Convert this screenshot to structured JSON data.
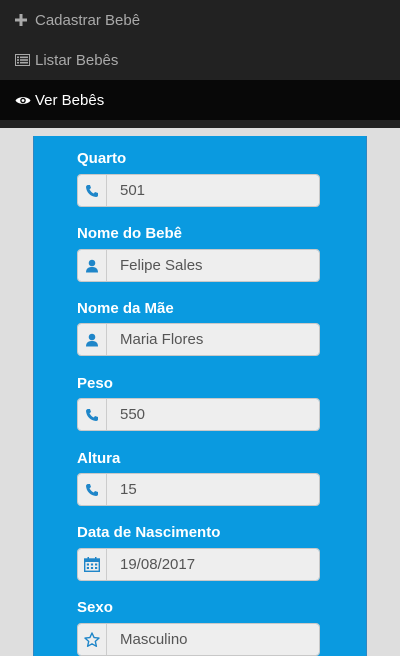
{
  "nav": {
    "items": [
      {
        "label": "Cadastrar Bebê",
        "icon": "plus-icon"
      },
      {
        "label": "Listar Bebês",
        "icon": "list-icon"
      },
      {
        "label": "Ver Bebês",
        "icon": "eye-icon"
      }
    ],
    "active_index": 2
  },
  "form": {
    "fields": [
      {
        "label": "Quarto",
        "value": "501",
        "icon": "phone-icon"
      },
      {
        "label": "Nome do Bebê",
        "value": "Felipe Sales",
        "icon": "user-icon"
      },
      {
        "label": "Nome da Mãe",
        "value": "Maria Flores",
        "icon": "user-icon"
      },
      {
        "label": "Peso",
        "value": "550",
        "icon": "phone-icon"
      },
      {
        "label": "Altura",
        "value": "15",
        "icon": "phone-icon"
      },
      {
        "label": "Data de Nascimento",
        "value": "19/08/2017",
        "icon": "calendar-icon"
      },
      {
        "label": "Sexo",
        "value": "Masculino",
        "icon": "star-icon"
      }
    ]
  },
  "colors": {
    "nav_bg": "#222222",
    "nav_active_bg": "#080808",
    "panel_bg": "#0a9ae0",
    "icon_blue": "#1f86c9",
    "page_bg": "#dedede"
  }
}
